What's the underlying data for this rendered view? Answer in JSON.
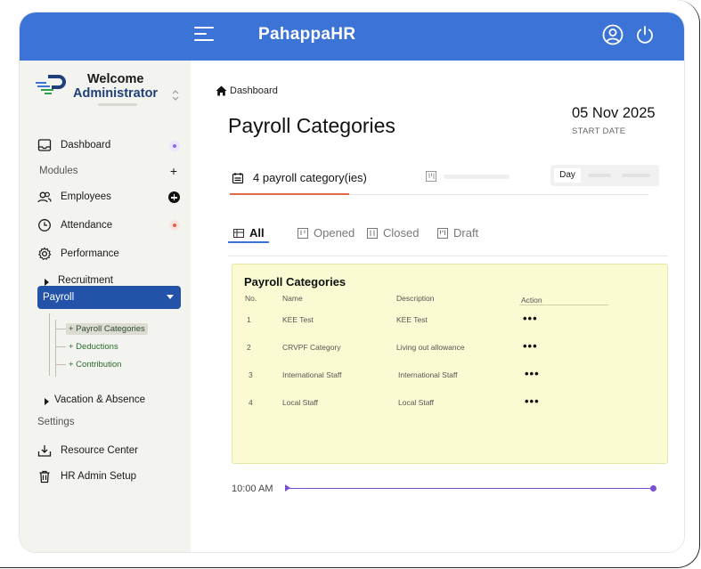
{
  "header": {
    "brand": "PahappaHR",
    "menu_icon": "hamburger-menu-icon",
    "user_icon": "user-circle-icon",
    "power_icon": "power-icon",
    "color": "#3b73d6"
  },
  "sidebar": {
    "welcome": "Welcome",
    "user_role": "Administrator",
    "items": [
      {
        "label": "Dashboard",
        "icon": "inbox-icon"
      },
      {
        "label": "Employees",
        "icon": "users-icon"
      },
      {
        "label": "Attendance",
        "icon": "clock-icon"
      },
      {
        "label": "Performance",
        "icon": "gear-icon"
      },
      {
        "label": "Recruitment",
        "icon": "caret-right-icon"
      },
      {
        "label": "Payroll",
        "icon": "caret-down-icon"
      },
      {
        "label": "Vacation & Absence",
        "icon": "caret-right-icon"
      },
      {
        "label": "Resource Center",
        "icon": "download-tray-icon"
      },
      {
        "label": "HR Admin Setup",
        "icon": "trash-icon"
      }
    ],
    "sections": {
      "modules": "Modules",
      "settings": "Settings"
    },
    "payroll_sub": [
      {
        "label": "+ Payroll Categories"
      },
      {
        "label": "+ Deductions"
      },
      {
        "label": "+ Contribution"
      }
    ],
    "active_color": "#2353a8"
  },
  "main": {
    "breadcrumb": "Dashboard",
    "page_title": "Payroll Categories",
    "date": "05 Nov 2025",
    "date_label": "START DATE",
    "category_count": "4 payroll category(ies)",
    "segment_day": "Day",
    "tabs": [
      {
        "label": "All"
      },
      {
        "label": "Opened"
      },
      {
        "label": "Closed"
      },
      {
        "label": "Draft"
      }
    ],
    "table": {
      "title": "Payroll Categories",
      "headers": [
        "No.",
        "Name",
        "Description",
        "Action"
      ],
      "rows": [
        {
          "no": "1",
          "name": "KEE Test",
          "description": "KEE Test",
          "action": "•••"
        },
        {
          "no": "2",
          "name": "CRVPF Category",
          "description": "Living out allowance",
          "action": "•••"
        },
        {
          "no": "3",
          "name": "International Staff",
          "description": "International Staff",
          "action": "•••"
        },
        {
          "no": "4",
          "name": "Local Staff",
          "description": "Local Staff",
          "action": "•••"
        }
      ],
      "background": "#fbfbd3"
    },
    "time": "10:00 AM",
    "timeline_color": "#7b4fd6"
  }
}
